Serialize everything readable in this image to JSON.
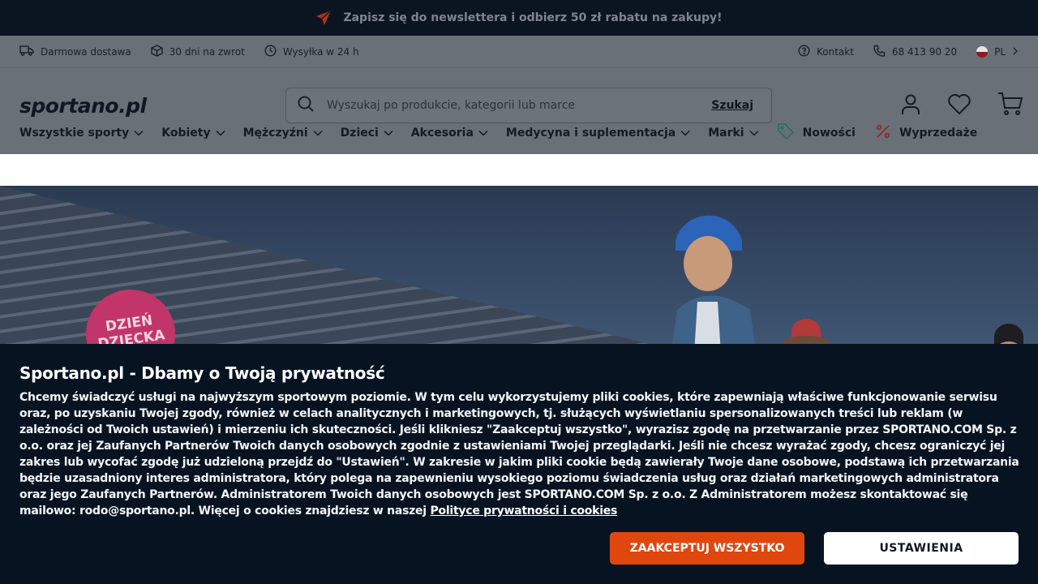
{
  "promo": {
    "text": "Zapisz się do newslettera i odbierz 50 zł rabatu na zakupy!"
  },
  "info_bar": {
    "left": [
      {
        "icon": "truck-icon",
        "label": "Darmowa dostawa"
      },
      {
        "icon": "box-icon",
        "label": "30 dni na zwrot"
      },
      {
        "icon": "clock-icon",
        "label": "Wysyłka w 24 h"
      }
    ],
    "contact": "Kontakt",
    "phone": "68 413 90 20",
    "language": "PL"
  },
  "header": {
    "logo": "sportano.pl",
    "search_placeholder": "Wyszukaj po produkcie, kategorii lub marce",
    "search_button": "Szukaj"
  },
  "nav": {
    "items": [
      {
        "label": "Wszystkie sporty"
      },
      {
        "label": "Kobiety"
      },
      {
        "label": "Mężczyźni"
      },
      {
        "label": "Dzieci"
      },
      {
        "label": "Akcesoria"
      },
      {
        "label": "Medycyna i suplementacja"
      },
      {
        "label": "Marki"
      }
    ],
    "new_label": "Nowości",
    "sale_label": "Wyprzedaże"
  },
  "hero": {
    "badge_line1": "DZIEŃ",
    "badge_line2": "DZIECKA"
  },
  "cookie": {
    "title": "Sportano.pl - Dbamy o Twoją prywatność",
    "body": "Chcemy świadczyć usługi na najwyższym sportowym poziomie. W tym celu wykorzystujemy pliki cookies, które zapewniają właściwe funkcjonowanie serwisu oraz, po uzyskaniu Twojej zgody, również w celach analitycznych i marketingowych, tj. służących wyświetlaniu spersonalizowanych treści lub reklam (w zależności od Twoich ustawień) i mierzeniu ich skuteczności. Jeśli klikniesz \"Zaakceptuj wszystko\", wyrazisz zgodę na przetwarzanie przez SPORTANO.COM Sp. z o.o. oraz jej Zaufanych Partnerów Twoich danych osobowych zgodnie z ustawieniami Twojej przeglądarki. Jeśli nie chcesz wyrażać zgody, chcesz ograniczyć jej zakres lub wycofać zgodę już udzieloną przejdź do \"Ustawień\". W zakresie w jakim pliki cookie będą zawierały Twoje dane osobowe, podstawą ich przetwarzania będzie uzasadniony interes administratora, który polega na zapewnieniu wysokiego poziomu świadczenia usług oraz działań marketingowych administratora oraz jego Zaufanych Partnerów. Administratorem Twoich danych osobowych jest SPORTANO.COM Sp. z o.o. Z Administratorem możesz skontaktować się mailowo: rodo@sportano.pl. Więcej o cookies znajdziesz w naszej ",
    "policy_link": "Polityce prywatności i cookies",
    "accept_button": "ZAAKCEPTUJ WSZYSTKO",
    "settings_button": "USTAWIENIA"
  },
  "colors": {
    "accent": "#e0470f",
    "dark": "#081322",
    "promo_icon": "#c2311c"
  }
}
